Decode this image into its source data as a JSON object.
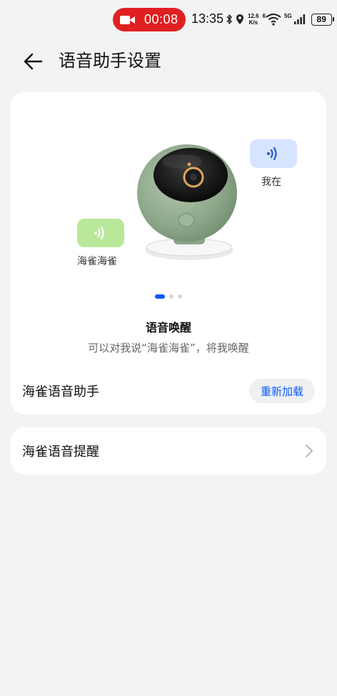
{
  "status_bar": {
    "record_time": "00:08",
    "clock": "13:35",
    "net_speed_value": "12.6",
    "net_speed_unit": "K/s",
    "network_type": "5G",
    "wifi_tag": "6",
    "battery": "89",
    "record_color": "#e02020"
  },
  "header": {
    "title": "语音助手设置",
    "back_icon": "arrow-left-icon"
  },
  "wake_card": {
    "bubble_right_caption": "我在",
    "bubble_left_caption": "海雀海雀",
    "bubble_right_color": "#d6e4ff",
    "bubble_left_color": "#b9e89a",
    "carousel": {
      "pages": 3,
      "active": 1,
      "active_color": "#0a59f7"
    },
    "title": "语音唤醒",
    "description": "可以对我说“海雀海雀”，将我唤醒",
    "assistant_label": "海雀语音助手",
    "reload_label": "重新加载"
  },
  "reminder_card": {
    "label": "海雀语音提醒",
    "chevron_icon": "chevron-right-icon"
  }
}
